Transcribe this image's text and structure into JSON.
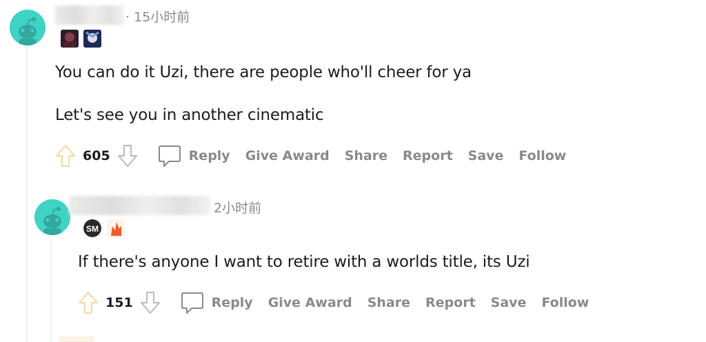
{
  "comments": [
    {
      "timestamp": "· 15小时前",
      "body": [
        "You can do it Uzi, there are people who'll cheer for ya",
        "Let's see you in another cinematic"
      ],
      "votes": "605",
      "actions": {
        "reply": "Reply",
        "give_award": "Give Award",
        "share": "Share",
        "report": "Report",
        "save": "Save",
        "follow": "Follow"
      }
    },
    {
      "timestamp": "2小时前",
      "body": [
        "If there's anyone I want to retire with a worlds title, its Uzi"
      ],
      "votes": "151",
      "actions": {
        "reply": "Reply",
        "give_award": "Give Award",
        "share": "Share",
        "report": "Report",
        "save": "Save",
        "follow": "Follow"
      }
    }
  ],
  "colors": {
    "avatar": "#3fd3c5",
    "muted": "#878a8c",
    "thread_line": "#edeff1",
    "upvote_hint": "#f6d9a3"
  }
}
